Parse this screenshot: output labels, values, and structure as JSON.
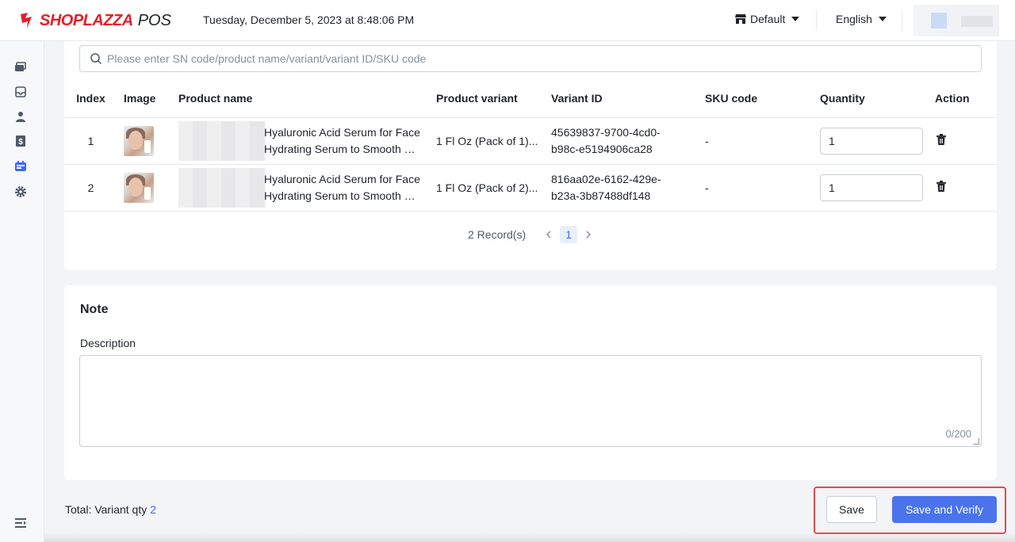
{
  "header": {
    "brand": "SHOPLAZZA",
    "brand_suffix": "POS",
    "datetime": "Tuesday, December 5, 2023 at 8:48:06 PM",
    "store": "Default",
    "language": "English",
    "brand_color": "#e4202b"
  },
  "sidebar": {
    "icons": [
      "orders-icon",
      "inbox-icon",
      "customer-icon",
      "finance-icon",
      "inventory-icon",
      "settings-icon",
      "collapse-menu-icon"
    ],
    "active_index": 4,
    "active_color": "#3c6af2"
  },
  "search": {
    "placeholder": "Please enter SN code/product name/variant/variant ID/SKU code",
    "value": ""
  },
  "table": {
    "columns": [
      "Index",
      "Image",
      "Product name",
      "Product variant",
      "Variant ID",
      "SKU code",
      "Quantity",
      "Action"
    ],
    "rows": [
      {
        "index": "1",
        "name_line1": "Hyaluronic Acid Serum for Face",
        "name_line2": "Hydrating Serum to Smooth Dr...",
        "variant": "1 Fl Oz (Pack of 1)...",
        "variant_id_line1": "45639837-9700-4cd0-",
        "variant_id_line2": "b98c-e5194906ca28",
        "sku": "-",
        "quantity": "1"
      },
      {
        "index": "2",
        "name_line1": "Hyaluronic Acid Serum for Face",
        "name_line2": "Hydrating Serum to Smooth Dr...",
        "variant": "1 Fl Oz (Pack of 2)...",
        "variant_id_line1": "816aa02e-6162-429e-",
        "variant_id_line2": "b23a-3b87488df148",
        "sku": "-",
        "quantity": "1"
      }
    ]
  },
  "pagination": {
    "records": "2 Record(s)",
    "current_page": "1"
  },
  "note": {
    "title": "Note",
    "description_label": "Description",
    "description_value": "",
    "counter": "0/200"
  },
  "footer": {
    "total_label": "Total: Variant qty",
    "total_qty": "2",
    "save_label": "Save",
    "save_verify_label": "Save and Verify",
    "primary_color": "#4a73ec",
    "highlight_color": "#e5484d"
  }
}
